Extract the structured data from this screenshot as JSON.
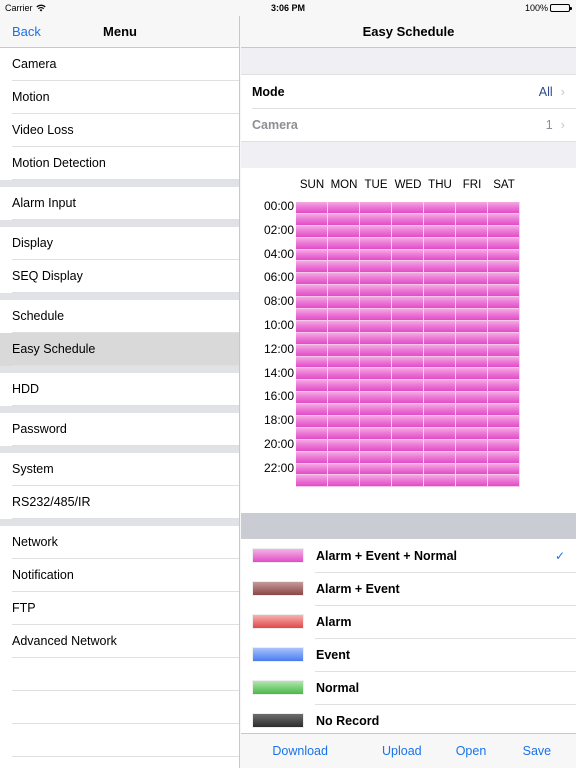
{
  "status_bar": {
    "carrier": "Carrier",
    "time": "3:06 PM",
    "battery": "100%"
  },
  "left": {
    "back_label": "Back",
    "title": "Menu",
    "groups": [
      [
        "Camera",
        "Motion",
        "Video Loss",
        "Motion Detection"
      ],
      [
        "Alarm Input"
      ],
      [
        "Display",
        "SEQ Display"
      ],
      [
        "Schedule",
        "Easy Schedule"
      ],
      [
        "HDD"
      ],
      [
        "Password"
      ],
      [
        "System",
        "RS232/485/IR"
      ],
      [
        "Network",
        "Notification",
        "FTP",
        "Advanced Network",
        "",
        "",
        ""
      ]
    ],
    "selected": "Easy Schedule"
  },
  "right": {
    "title": "Easy Schedule",
    "mode": {
      "label": "Mode",
      "value": "All"
    },
    "camera": {
      "label": "Camera",
      "value": "1"
    },
    "schedule": {
      "days": [
        "SUN",
        "MON",
        "TUE",
        "WED",
        "THU",
        "FRI",
        "SAT"
      ],
      "time_labels": [
        "00:00",
        "02:00",
        "04:00",
        "06:00",
        "08:00",
        "10:00",
        "12:00",
        "14:00",
        "16:00",
        "18:00",
        "20:00",
        "22:00"
      ],
      "hours_per_day": 24,
      "all_cells_mode": "Alarm + Event + Normal"
    },
    "legend": [
      {
        "label": "Alarm + Event + Normal",
        "selected": true,
        "colors": [
          "#f5b3e6",
          "#e04ec6"
        ]
      },
      {
        "label": "Alarm + Event",
        "selected": false,
        "colors": [
          "#c79a9a",
          "#8a4646"
        ]
      },
      {
        "label": "Alarm",
        "selected": false,
        "colors": [
          "#f7b1b1",
          "#e14848"
        ]
      },
      {
        "label": "Event",
        "selected": false,
        "colors": [
          "#a9c4fb",
          "#4a7cf0"
        ]
      },
      {
        "label": "Normal",
        "selected": false,
        "colors": [
          "#b4e6b0",
          "#49b848"
        ]
      },
      {
        "label": "No Record",
        "selected": false,
        "colors": [
          "#6d6d6d",
          "#2d2d2d"
        ]
      }
    ],
    "check_mark": "✓",
    "toolbar": [
      "Download",
      "Upload",
      "Open",
      "Save"
    ]
  }
}
